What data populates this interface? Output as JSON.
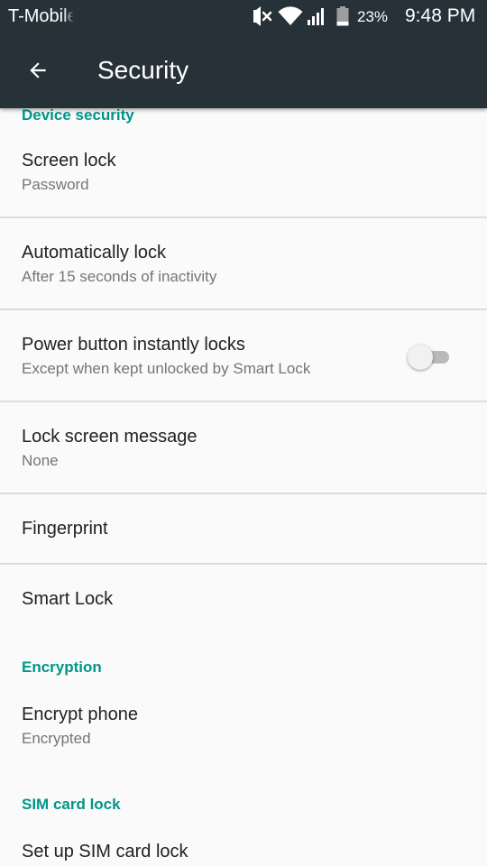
{
  "status_bar": {
    "carrier": "T-Mobile",
    "battery_percent": "23%",
    "time": "9:48 PM",
    "icons": [
      "vibrate-off-icon",
      "wifi-icon",
      "cellular-signal-icon",
      "battery-icon"
    ]
  },
  "app_bar": {
    "title": "Security",
    "back_icon": "arrow-back-icon",
    "background_color": "#263238"
  },
  "sections": {
    "device_security": {
      "header": "Device security",
      "screen_lock": {
        "title": "Screen lock",
        "summary": "Password"
      },
      "auto_lock": {
        "title": "Automatically lock",
        "summary": "After 15 seconds of inactivity"
      },
      "power_button": {
        "title": "Power button instantly locks",
        "summary": "Except when kept unlocked by Smart Lock",
        "toggle_on": false
      },
      "lock_message": {
        "title": "Lock screen message",
        "summary": "None"
      },
      "fingerprint": {
        "title": "Fingerprint"
      },
      "smart_lock": {
        "title": "Smart Lock"
      }
    },
    "encryption": {
      "header": "Encryption",
      "encrypt_phone": {
        "title": "Encrypt phone",
        "summary": "Encrypted"
      }
    },
    "sim_lock": {
      "header": "SIM card lock",
      "setup_sim_lock": {
        "title": "Set up SIM card lock"
      }
    }
  },
  "colors": {
    "accent": "#009688",
    "primary_text": "#212121",
    "secondary_text": "#757575",
    "background": "#fafafa"
  }
}
